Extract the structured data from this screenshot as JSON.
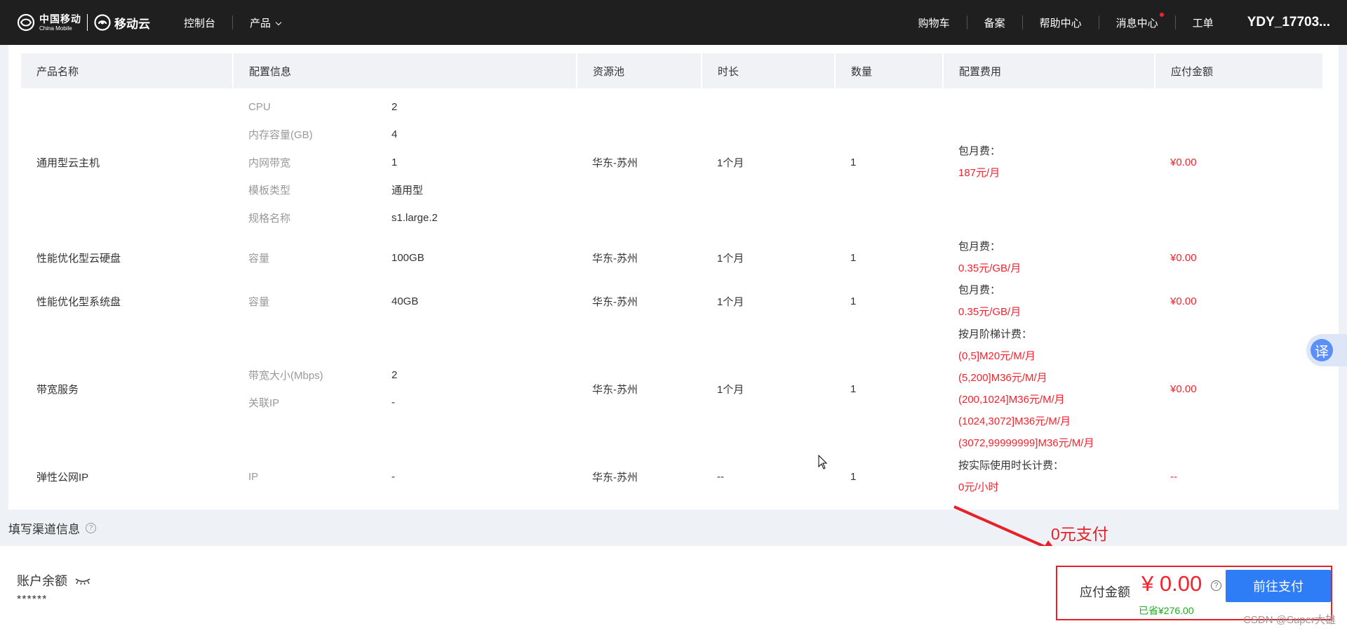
{
  "nav": {
    "brand_cn": "中国移动",
    "brand_en": "China Mobile",
    "cloud": "移动云",
    "left": [
      "控制台",
      "产品"
    ],
    "right": [
      "购物车",
      "备案",
      "帮助中心",
      "消息中心",
      "工单"
    ],
    "user": "YDY_17703..."
  },
  "table": {
    "headers": [
      "产品名称",
      "配置信息",
      "资源池",
      "时长",
      "数量",
      "配置费用",
      "应付金额"
    ],
    "rows": [
      {
        "name": "通用型云主机",
        "config": [
          {
            "k": "CPU",
            "v": "2"
          },
          {
            "k": "内存容量(GB)",
            "v": "4"
          },
          {
            "k": "内网带宽",
            "v": "1"
          },
          {
            "k": "模板类型",
            "v": "通用型"
          },
          {
            "k": "规格名称",
            "v": "s1.large.2"
          }
        ],
        "pool": "华东-苏州",
        "duration": "1个月",
        "qty": "1",
        "fee_label": "包月费：",
        "fee_lines": [
          "187元/月"
        ],
        "amount": "¥0.00"
      },
      {
        "name": "性能优化型云硬盘",
        "config": [
          {
            "k": "容量",
            "v": "100GB"
          }
        ],
        "pool": "华东-苏州",
        "duration": "1个月",
        "qty": "1",
        "fee_label": "包月费：",
        "fee_lines": [
          "0.35元/GB/月"
        ],
        "amount": "¥0.00"
      },
      {
        "name": "性能优化型系统盘",
        "config": [
          {
            "k": "容量",
            "v": "40GB"
          }
        ],
        "pool": "华东-苏州",
        "duration": "1个月",
        "qty": "1",
        "fee_label": "包月费：",
        "fee_lines": [
          "0.35元/GB/月"
        ],
        "amount": "¥0.00"
      },
      {
        "name": "带宽服务",
        "config": [
          {
            "k": "带宽大小(Mbps)",
            "v": "2"
          },
          {
            "k": "关联IP",
            "v": "-"
          }
        ],
        "pool": "华东-苏州",
        "duration": "1个月",
        "qty": "1",
        "fee_label": "按月阶梯计费：",
        "fee_lines": [
          "(0,5]M20元/M/月",
          "(5,200]M36元/M/月",
          "(200,1024]M36元/M/月",
          "(1024,3072]M36元/M/月",
          "(3072,99999999]M36元/M/月"
        ],
        "amount": "¥0.00"
      },
      {
        "name": "弹性公网IP",
        "config": [
          {
            "k": "IP",
            "v": "-"
          }
        ],
        "pool": "华东-苏州",
        "duration": "--",
        "qty": "1",
        "fee_label": "按实际使用时长计费：",
        "fee_lines": [
          "0元/小时"
        ],
        "amount": "--"
      }
    ]
  },
  "channel": {
    "title": "填写渠道信息",
    "help": "?"
  },
  "bottom": {
    "balance_label": "账户余额",
    "balance_mask": "******",
    "pay_label": "应付金额",
    "pay_amount": "¥ 0.00",
    "help": "?",
    "saved": "已省¥276.00",
    "pay_button": "前往支付"
  },
  "annotation": {
    "text": "0元支付",
    "color": "#e6212a"
  },
  "translate_label": "译",
  "watermark": "CSDN @Super大雄",
  "colors": {
    "nav_bg": "#1f1f1f",
    "price_red": "#f5222d",
    "primary_blue": "#2f7df6",
    "saved_green": "#1aad19"
  }
}
